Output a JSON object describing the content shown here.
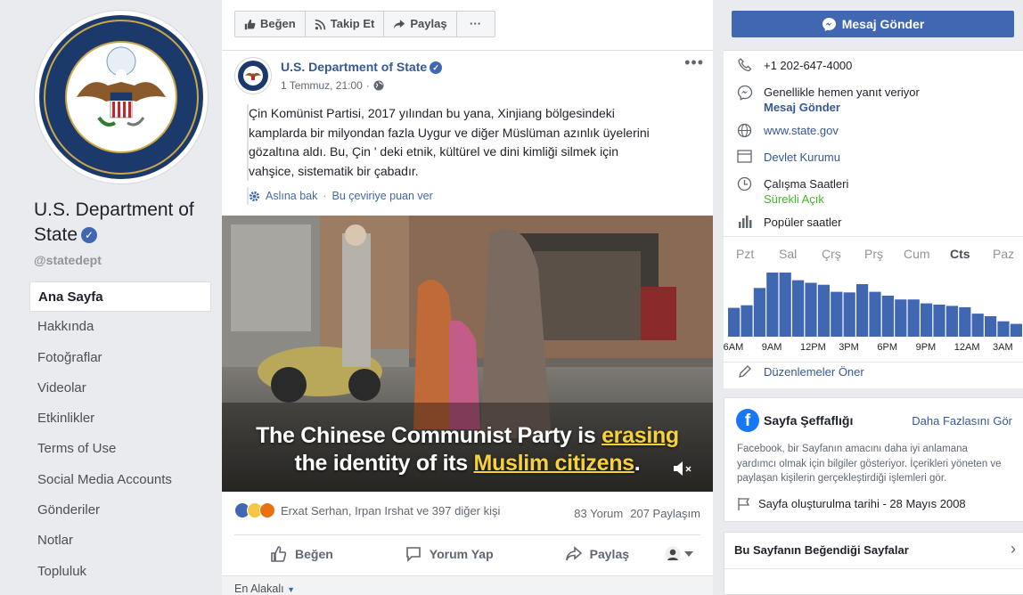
{
  "page": {
    "name": "U.S. Department of State",
    "handle": "@statedept"
  },
  "nav": [
    {
      "label": "Ana Sayfa",
      "active": true
    },
    {
      "label": "Hakkında"
    },
    {
      "label": "Fotoğraflar"
    },
    {
      "label": "Videolar"
    },
    {
      "label": "Etkinlikler"
    },
    {
      "label": "Terms of Use"
    },
    {
      "label": "Social Media Accounts"
    },
    {
      "label": "Gönderiler"
    },
    {
      "label": "Notlar"
    },
    {
      "label": "Topluluk"
    }
  ],
  "toolbar": {
    "like": "Beğen",
    "follow": "Takip Et",
    "share": "Paylaş",
    "more": "···"
  },
  "send_message": "Mesaj Gönder",
  "post": {
    "author": "U.S. Department of State",
    "date": "1 Temmuz, 21:00",
    "text_lines": [
      "Çin Komünist Partisi, 2017 yılından bu yana, Xinjiang bölgesindeki",
      "kamplarda bir milyondan fazla Uygur ve diğer Müslüman azınlık üyelerini",
      "gözaltına aldı. Bu, Çin ' deki etnik, kültürel ve dini kimliği silmek için",
      "vahşice, sistematik bir çabadır."
    ],
    "see_original": "Aslına bak",
    "rate_translation": "Bu çeviriye puan ver",
    "video_caption": {
      "line1_a": "The Chinese Communist Party is ",
      "line1_hl": "erasing",
      "line2_a": "the identity of its ",
      "line2_hl": "Muslim citizens",
      "line2_b": "."
    },
    "reactions_text": "Erxat Serhan, Irpan Irshat ve 397 diğer kişi",
    "comments_count": "83 Yorum",
    "shares_count": "207 Paylaşım",
    "actions": {
      "like": "Beğen",
      "comment": "Yorum Yap",
      "share": "Paylaş"
    },
    "sort_label": "En Alakalı"
  },
  "info": {
    "phone": "+1 202-647-4000",
    "response": "Genellikle hemen yanıt veriyor",
    "send_message_link": "Mesaj Gönder",
    "website": "www.state.gov",
    "category": "Devlet Kurumu",
    "hours_label": "Çalışma Saatleri",
    "hours_value": "Sürekli Açık",
    "popular_times": "Popüler saatler",
    "suggest_edits": "Düzenlemeler Öner"
  },
  "transparency": {
    "title": "Sayfa Şeffaflığı",
    "more": "Daha Fazlasını Gör",
    "description_lines": [
      "Facebook, bir Sayfanın amacını daha iyi anlamana",
      "yardımcı olmak için bilgiler gösteriyor. İçerikleri yöneten ve",
      "paylaşan kişilerin gerçekleştirdiği işlemleri gör."
    ],
    "created": "Sayfa oluşturulma tarihi - 28 Mayıs 2008"
  },
  "liked_pages": {
    "title": "Bu Sayfanın Beğendiği Sayfalar"
  },
  "colors": {
    "brand": "#4267b2",
    "bar": "#4267b2",
    "link": "#365899",
    "green": "#42b72a"
  },
  "chart_data": {
    "type": "bar",
    "title": "Popüler saatler",
    "days": [
      "Pzt",
      "Sal",
      "Çrş",
      "Prş",
      "Cum",
      "Cts",
      "Paz"
    ],
    "active_day": "Cts",
    "x_tick_labels": [
      "6AM",
      "9AM",
      "12PM",
      "3PM",
      "6PM",
      "9PM",
      "12AM",
      "3AM"
    ],
    "categories": [
      "6AM",
      "7AM",
      "8AM",
      "9AM",
      "10AM",
      "11AM",
      "12PM",
      "1PM",
      "2PM",
      "3PM",
      "4PM",
      "5PM",
      "6PM",
      "7PM",
      "8PM",
      "9PM",
      "10PM",
      "11PM",
      "12AM",
      "1AM",
      "2AM",
      "3AM",
      "4AM"
    ],
    "values": [
      45,
      49,
      76,
      100,
      100,
      88,
      84,
      81,
      70,
      69,
      82,
      70,
      64,
      58,
      58,
      52,
      50,
      48,
      46,
      36,
      32,
      24,
      20
    ],
    "ylim": [
      0,
      100
    ]
  }
}
